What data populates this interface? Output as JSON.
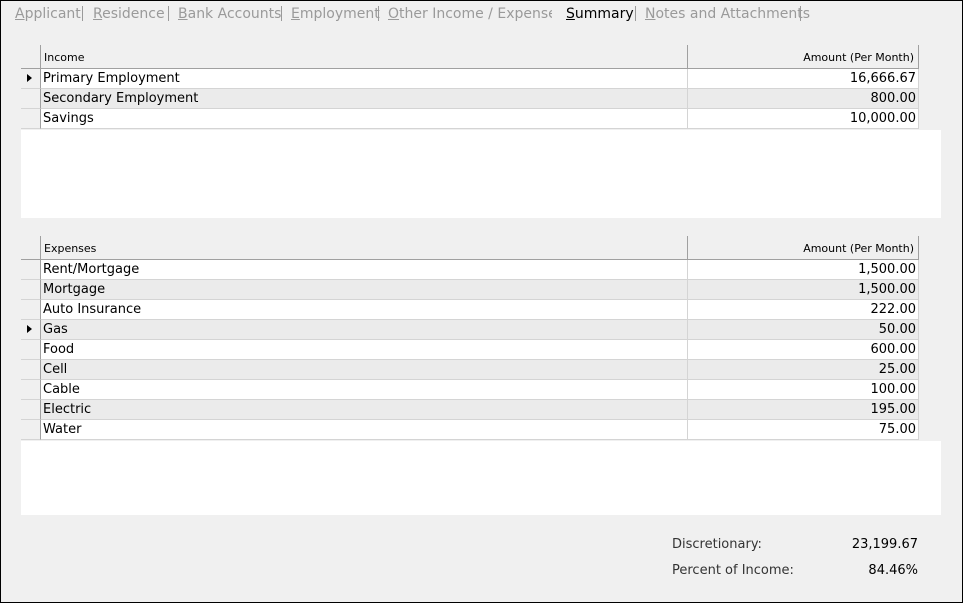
{
  "tabs": [
    {
      "pre": "",
      "u": "A",
      "post": "pplicant"
    },
    {
      "pre": "",
      "u": "R",
      "post": "esidence"
    },
    {
      "pre": "",
      "u": "B",
      "post": "ank Accounts"
    },
    {
      "pre": "",
      "u": "E",
      "post": "mployment"
    },
    {
      "pre": "",
      "u": "O",
      "post": "ther Income / Expenses"
    },
    {
      "pre": "",
      "u": "S",
      "post": "ummary"
    },
    {
      "pre": "",
      "u": "N",
      "post": "otes and Attachments"
    }
  ],
  "income": {
    "header_name": "Income",
    "header_amount": "Amount (Per Month)",
    "rows": [
      {
        "name": "Primary Employment",
        "amount": "16,666.67",
        "current": true
      },
      {
        "name": "Secondary Employment",
        "amount": "800.00",
        "current": false
      },
      {
        "name": "Savings",
        "amount": "10,000.00",
        "current": false
      }
    ]
  },
  "expenses": {
    "header_name": "Expenses",
    "header_amount": "Amount (Per Month)",
    "rows": [
      {
        "name": "Rent/Mortgage",
        "amount": "1,500.00",
        "current": false
      },
      {
        "name": "Mortgage",
        "amount": "1,500.00",
        "current": false
      },
      {
        "name": "Auto Insurance",
        "amount": "222.00",
        "current": false
      },
      {
        "name": "Gas",
        "amount": "50.00",
        "current": true
      },
      {
        "name": "Food",
        "amount": "600.00",
        "current": false
      },
      {
        "name": "Cell",
        "amount": "25.00",
        "current": false
      },
      {
        "name": "Cable",
        "amount": "100.00",
        "current": false
      },
      {
        "name": "Electric",
        "amount": "195.00",
        "current": false
      },
      {
        "name": "Water",
        "amount": "75.00",
        "current": false
      }
    ]
  },
  "summary": {
    "discretionary_label": "Discretionary:",
    "discretionary_value": "23,199.67",
    "percent_label": "Percent of Income:",
    "percent_value": "84.46%"
  }
}
